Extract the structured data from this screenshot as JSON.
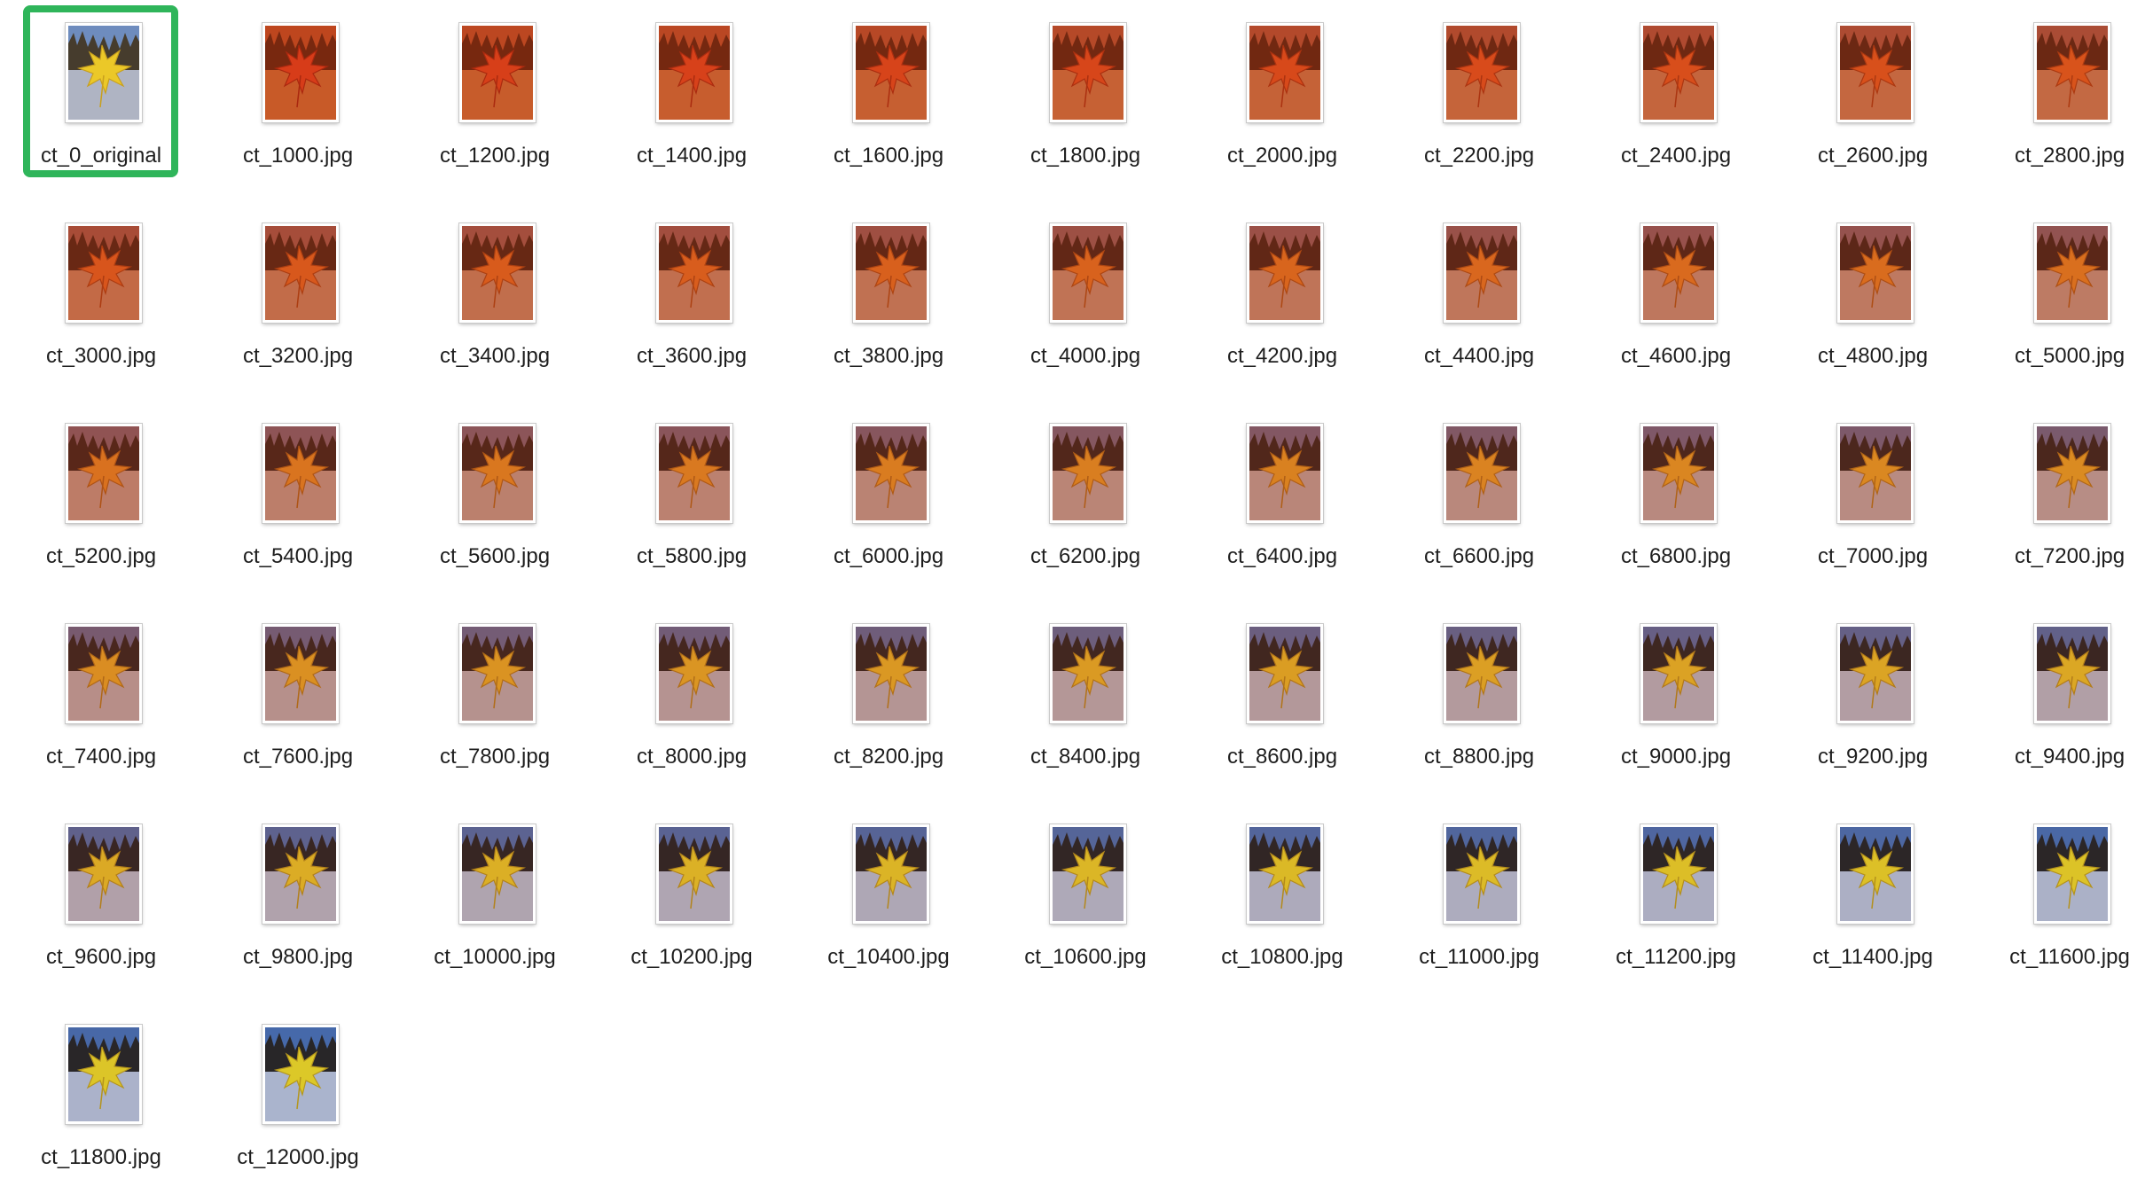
{
  "files": [
    {
      "name": "ct_0_original",
      "selected": true
    },
    {
      "name": "ct_1000.jpg"
    },
    {
      "name": "ct_1200.jpg"
    },
    {
      "name": "ct_1400.jpg"
    },
    {
      "name": "ct_1600.jpg"
    },
    {
      "name": "ct_1800.jpg"
    },
    {
      "name": "ct_2000.jpg"
    },
    {
      "name": "ct_2200.jpg"
    },
    {
      "name": "ct_2400.jpg"
    },
    {
      "name": "ct_2600.jpg"
    },
    {
      "name": "ct_2800.jpg"
    },
    {
      "name": "ct_3000.jpg"
    },
    {
      "name": "ct_3200.jpg"
    },
    {
      "name": "ct_3400.jpg"
    },
    {
      "name": "ct_3600.jpg"
    },
    {
      "name": "ct_3800.jpg"
    },
    {
      "name": "ct_4000.jpg"
    },
    {
      "name": "ct_4200.jpg"
    },
    {
      "name": "ct_4400.jpg"
    },
    {
      "name": "ct_4600.jpg"
    },
    {
      "name": "ct_4800.jpg"
    },
    {
      "name": "ct_5000.jpg"
    },
    {
      "name": "ct_5200.jpg"
    },
    {
      "name": "ct_5400.jpg"
    },
    {
      "name": "ct_5600.jpg"
    },
    {
      "name": "ct_5800.jpg"
    },
    {
      "name": "ct_6000.jpg"
    },
    {
      "name": "ct_6200.jpg"
    },
    {
      "name": "ct_6400.jpg"
    },
    {
      "name": "ct_6600.jpg"
    },
    {
      "name": "ct_6800.jpg"
    },
    {
      "name": "ct_7000.jpg"
    },
    {
      "name": "ct_7200.jpg"
    },
    {
      "name": "ct_7400.jpg"
    },
    {
      "name": "ct_7600.jpg"
    },
    {
      "name": "ct_7800.jpg"
    },
    {
      "name": "ct_8000.jpg"
    },
    {
      "name": "ct_8200.jpg"
    },
    {
      "name": "ct_8400.jpg"
    },
    {
      "name": "ct_8600.jpg"
    },
    {
      "name": "ct_8800.jpg"
    },
    {
      "name": "ct_9000.jpg"
    },
    {
      "name": "ct_9200.jpg"
    },
    {
      "name": "ct_9400.jpg"
    },
    {
      "name": "ct_9600.jpg"
    },
    {
      "name": "ct_9800.jpg"
    },
    {
      "name": "ct_10000.jpg"
    },
    {
      "name": "ct_10200.jpg"
    },
    {
      "name": "ct_10400.jpg"
    },
    {
      "name": "ct_10600.jpg"
    },
    {
      "name": "ct_10800.jpg"
    },
    {
      "name": "ct_11000.jpg"
    },
    {
      "name": "ct_11200.jpg"
    },
    {
      "name": "ct_11400.jpg"
    },
    {
      "name": "ct_11600.jpg"
    },
    {
      "name": "ct_11800.jpg"
    },
    {
      "name": "ct_12000.jpg"
    }
  ],
  "colors": {
    "selection": "#2fb55a",
    "label_text": "#1e1e1e",
    "background": "#ffffff"
  }
}
